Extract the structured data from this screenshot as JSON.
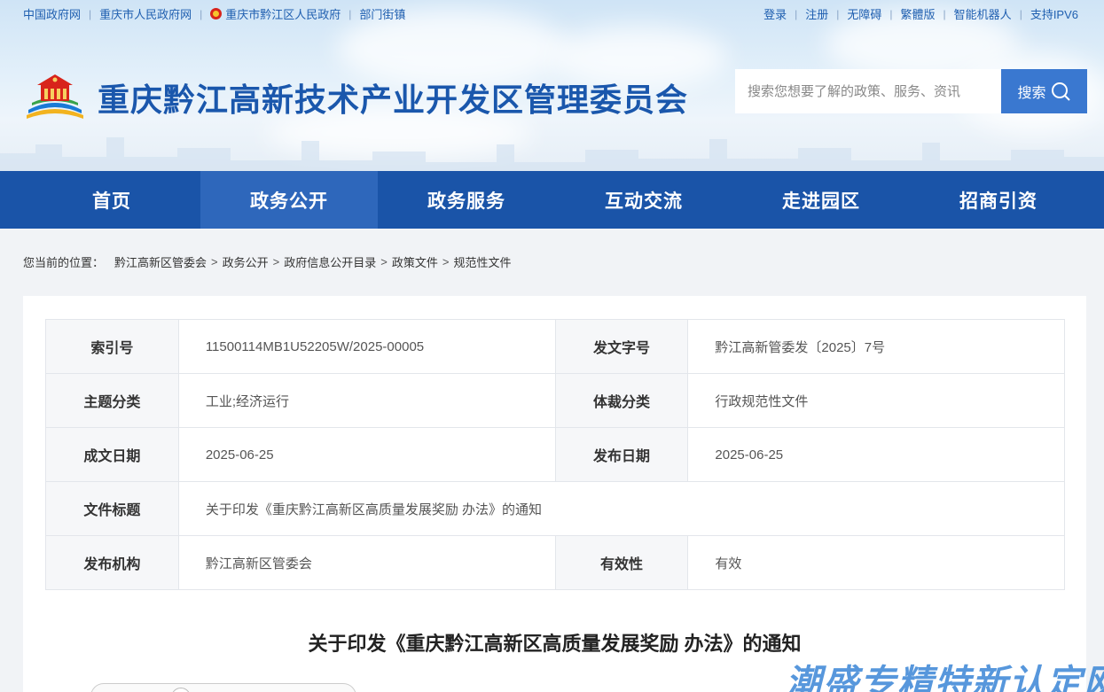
{
  "top_links_left": [
    "中国政府网",
    "重庆市人民政府网",
    "重庆市黔江区人民政府",
    "部门街镇"
  ],
  "top_links_right": [
    "登录",
    "注册",
    "无障碍",
    "繁體版",
    "智能机器人",
    "支持IPV6"
  ],
  "site_title": "重庆黔江高新技术产业开发区管理委员会",
  "search": {
    "placeholder": "搜索您想要了解的政策、服务、资讯",
    "button_label": "搜索"
  },
  "nav": [
    "首页",
    "政务公开",
    "政务服务",
    "互动交流",
    "走进园区",
    "招商引资"
  ],
  "nav_active": "政务公开",
  "breadcrumb": {
    "prefix": "您当前的位置：",
    "items": [
      "黔江高新区管委会",
      "政务公开",
      "政府信息公开目录",
      "政策文件",
      "规范性文件"
    ]
  },
  "meta": {
    "index_label": "索引号",
    "index_value": "11500114MB1U52205W/2025-00005",
    "docno_label": "发文字号",
    "docno_value": "黔江高新管委发〔2025〕7号",
    "topic_label": "主题分类",
    "topic_value": "工业;经济运行",
    "genre_label": "体裁分类",
    "genre_value": "行政规范性文件",
    "written_label": "成文日期",
    "written_value": "2025-06-25",
    "published_label": "发布日期",
    "published_value": "2025-06-25",
    "title_label": "文件标题",
    "title_value": "关于印发《重庆黔江高新区高质量发展奖励 办法》的通知",
    "org_label": "发布机构",
    "org_value": "黔江高新区管委会",
    "valid_label": "有效性",
    "valid_value": "有效"
  },
  "doc_title": "关于印发《重庆黔江高新区高质量发展奖励 办法》的通知",
  "watermark": "潮盛专精特新认定网",
  "colors": {
    "brand_blue": "#1a54a8",
    "nav_active": "#2e67bb",
    "search_button": "#3a78d0",
    "title_blue": "#1a57ac"
  }
}
